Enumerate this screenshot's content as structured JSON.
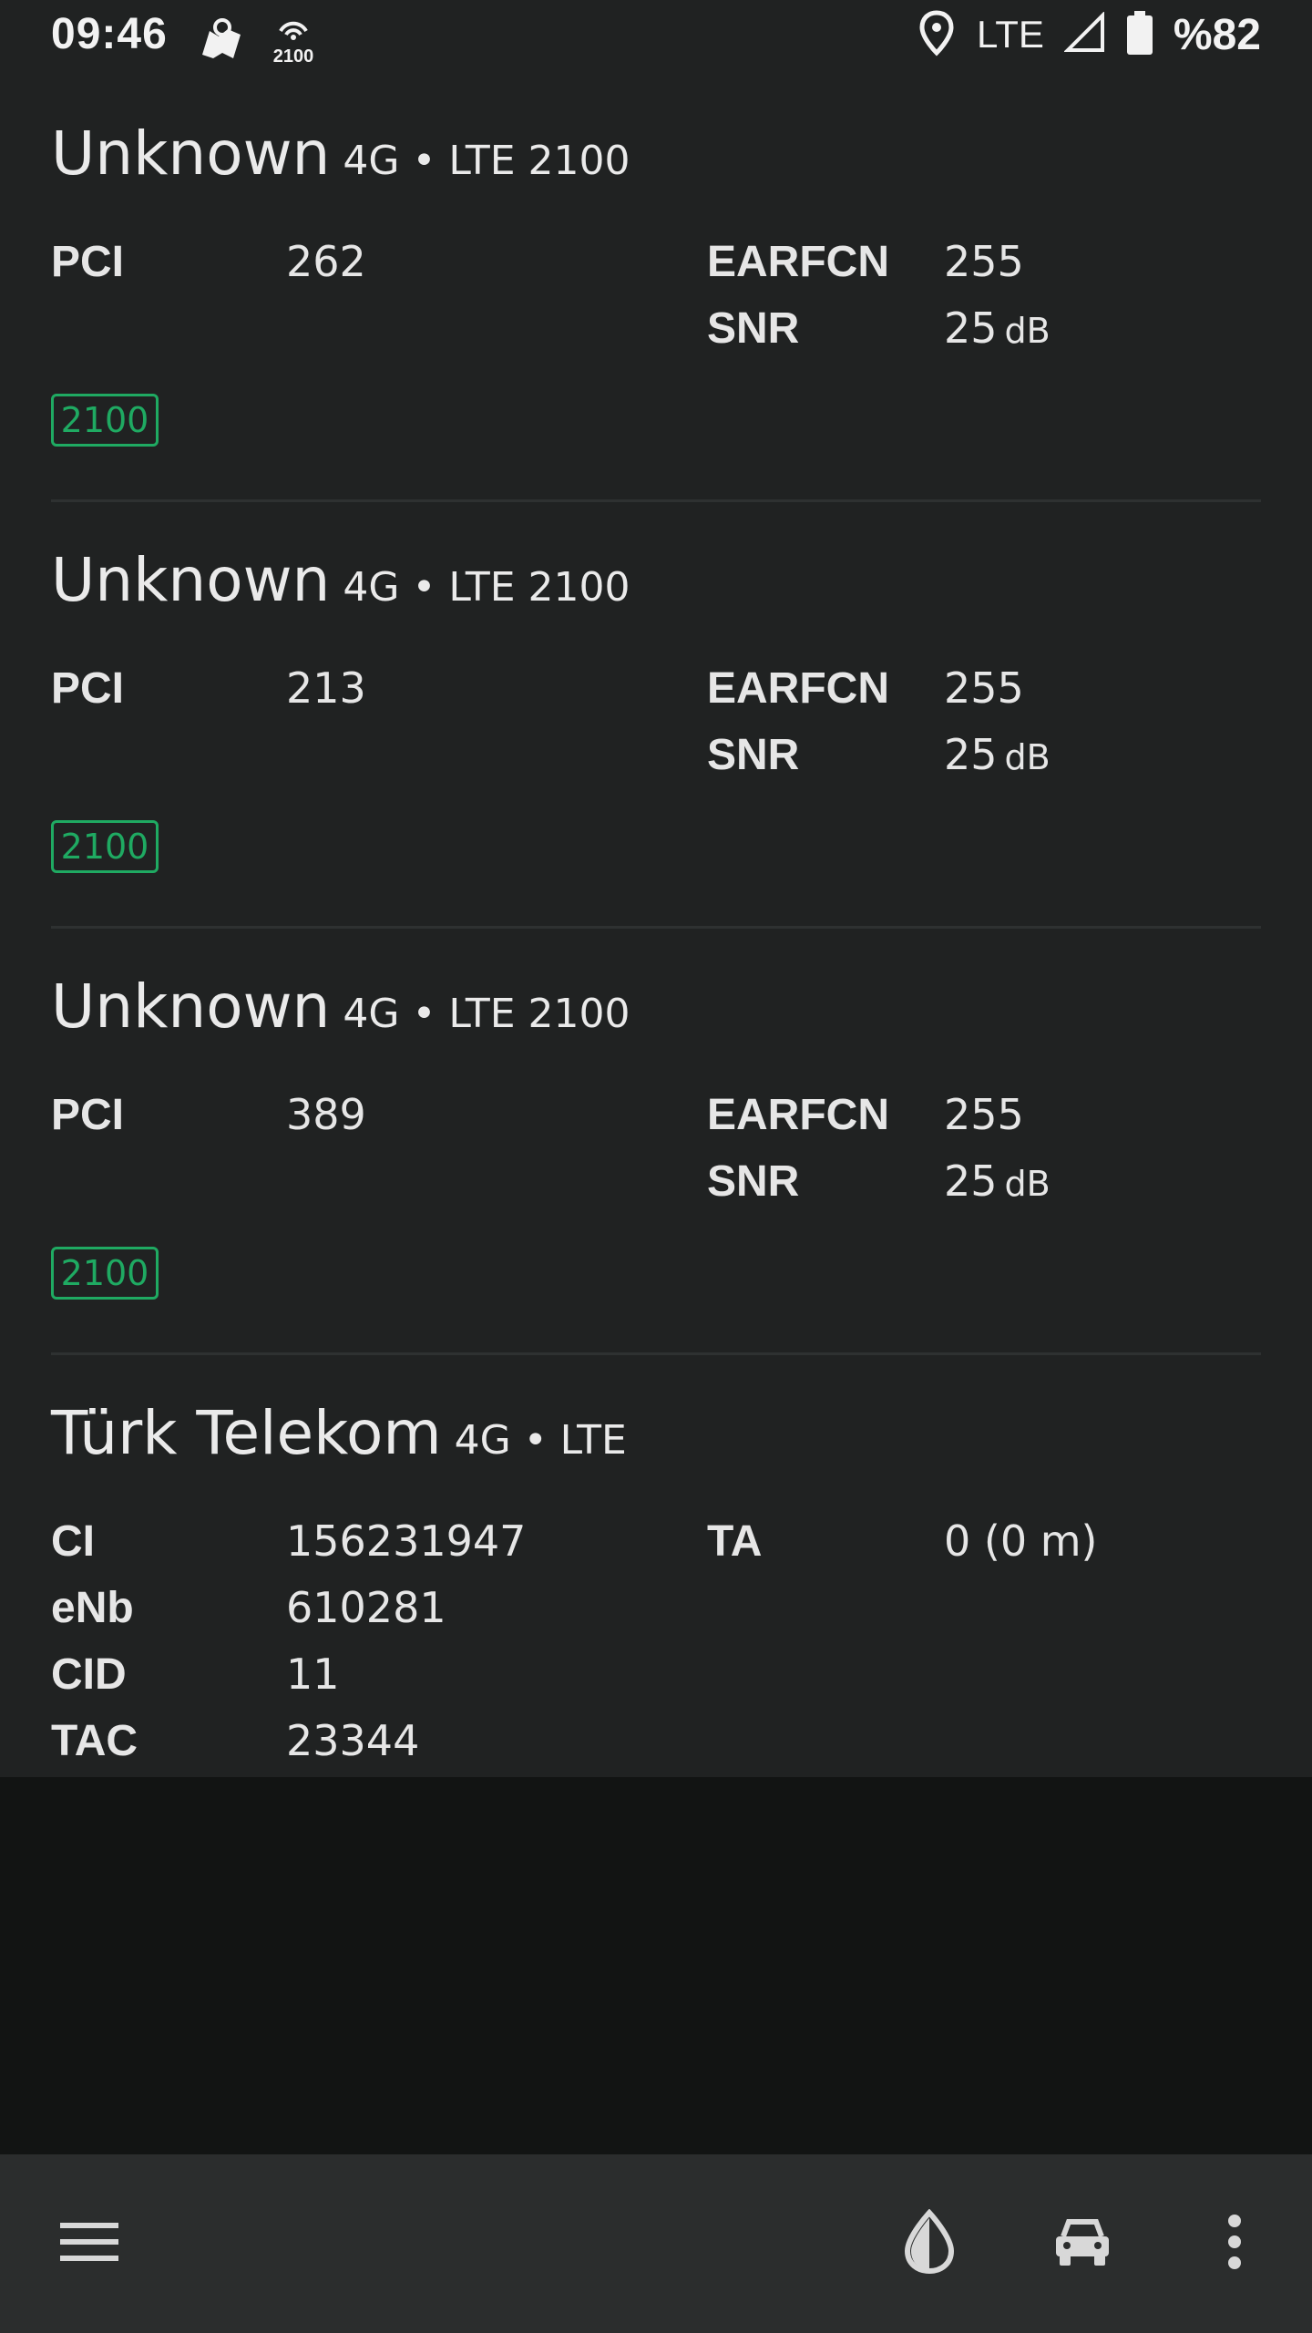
{
  "status_bar": {
    "time": "09:46",
    "notification_icons": [
      "map-icon",
      "cell-tower-2100-icon"
    ],
    "network": "LTE",
    "battery": "%82"
  },
  "cells": [
    {
      "operator": "Unknown",
      "tech": "4G • LTE 2100",
      "left": [
        {
          "label": "PCI",
          "value": "262"
        }
      ],
      "right": [
        {
          "label": "EARFCN",
          "value": "255"
        },
        {
          "label": "SNR",
          "value": "25",
          "unit": "dB"
        }
      ],
      "band": "2100"
    },
    {
      "operator": "Unknown",
      "tech": "4G • LTE 2100",
      "left": [
        {
          "label": "PCI",
          "value": "213"
        }
      ],
      "right": [
        {
          "label": "EARFCN",
          "value": "255"
        },
        {
          "label": "SNR",
          "value": "25",
          "unit": "dB"
        }
      ],
      "band": "2100"
    },
    {
      "operator": "Unknown",
      "tech": "4G • LTE 2100",
      "left": [
        {
          "label": "PCI",
          "value": "389"
        }
      ],
      "right": [
        {
          "label": "EARFCN",
          "value": "255"
        },
        {
          "label": "SNR",
          "value": "25",
          "unit": "dB"
        }
      ],
      "band": "2100"
    },
    {
      "operator": "Türk Telekom",
      "tech": "4G • LTE",
      "left": [
        {
          "label": "CI",
          "value": "156231947"
        },
        {
          "label": "eNb",
          "value": "610281"
        },
        {
          "label": "CID",
          "value": "11"
        },
        {
          "label": "TAC",
          "value": "23344"
        }
      ],
      "right": [
        {
          "label": "TA",
          "value": "0 (0 m)"
        }
      ]
    }
  ],
  "bottom_bar": {
    "icons": [
      "menu-icon",
      "theme-drop-icon",
      "car-mode-icon",
      "more-vert-icon"
    ]
  },
  "colors": {
    "background": "#202222",
    "band_accent": "#1faa62",
    "bottom_bar": "#2b2d2d"
  }
}
